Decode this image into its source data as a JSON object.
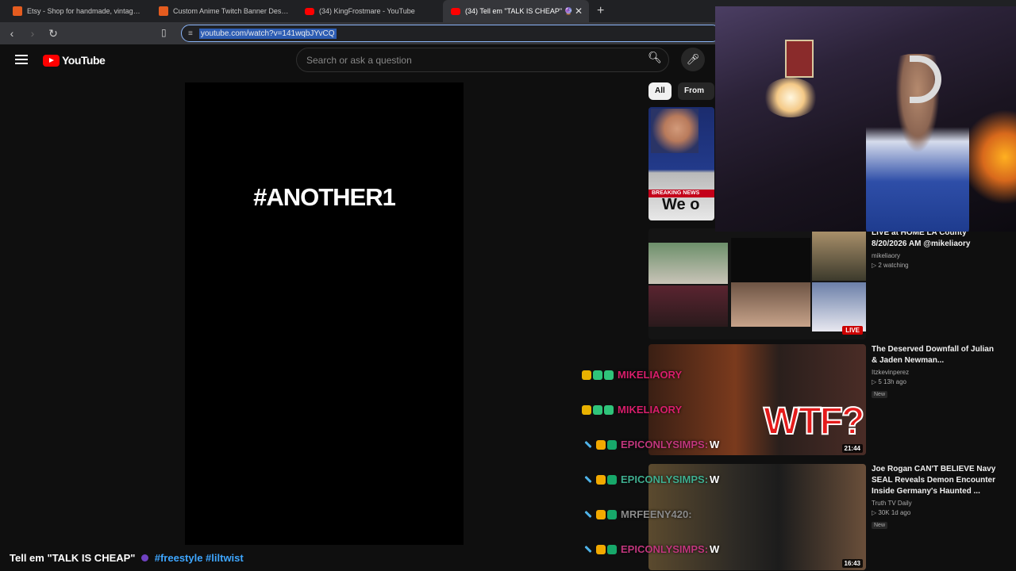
{
  "browser": {
    "tabs": [
      {
        "title": "Etsy - Shop for handmade, vintage, c",
        "icon": "etsy-icon"
      },
      {
        "title": "Custom Anime Twitch Banner Design",
        "icon": "etsy-icon"
      },
      {
        "title": "(34) KingFrostmare - YouTube",
        "icon": "youtube-icon"
      },
      {
        "title": "(34) Tell em \"TALK IS CHEAP\" 🔮",
        "icon": "youtube-icon",
        "active": true
      }
    ],
    "close_tab_glyph": "✕",
    "new_tab_glyph": "+",
    "url": "youtube.com/watch?v=141wqbJYvCQ"
  },
  "youtube": {
    "logo_text": "YouTube",
    "search_placeholder": "Search or ask a question",
    "chips": [
      "All",
      "From Lil"
    ],
    "overlay_text": "#ANOTHER1",
    "video_title": "Tell em \"TALK IS CHEAP\"",
    "video_tags": "#freestyle #liltwist",
    "sidebar": [
      {
        "title": "LIVE at HOME LA County 8/20/2026 AM @mikeliaory",
        "channel": "mikeliaory",
        "stats": "▷ 2 watching",
        "badge": "LIVE"
      },
      {
        "title": "The Deserved Downfall of Julian & Jaden Newman...",
        "channel": "Itzkevinperez",
        "stats": "▷ 5  13h ago",
        "tag": "New",
        "duration": "21:44"
      },
      {
        "title": "Joe Rogan CAN'T BELIEVE Navy SEAL Reveals Demon Encounter Inside Germany's Haunted ...",
        "channel": "Truth TV Daily",
        "stats": "▷ 30K  1d ago",
        "tag": "New",
        "duration": "16:43"
      }
    ],
    "thumb_text": {
      "breaking": "BREAKING NEWS",
      "headline": "We o",
      "wtf": "WTF?"
    }
  },
  "chat": [
    {
      "user": "MIKELIAORY",
      "message": "",
      "color": "#d81e6b"
    },
    {
      "user": "MIKELIAORY",
      "message": "",
      "color": "#d81e6b"
    },
    {
      "user": "EPICONLYSIMPS:",
      "message": "W",
      "color": "#c0367c"
    },
    {
      "user": "EPICONLYSIMPS:",
      "message": "W",
      "color": "#3fae8f"
    },
    {
      "user": "MRFEENY420:",
      "message": "",
      "color": "#8a8a8a"
    },
    {
      "user": "EPICONLYSIMPS:",
      "message": "W",
      "color": "#c0367c"
    }
  ],
  "colors": {
    "youtube_red": "#ff0000",
    "link_blue": "#3ea6ff",
    "page_bg": "#0f0f0f"
  }
}
